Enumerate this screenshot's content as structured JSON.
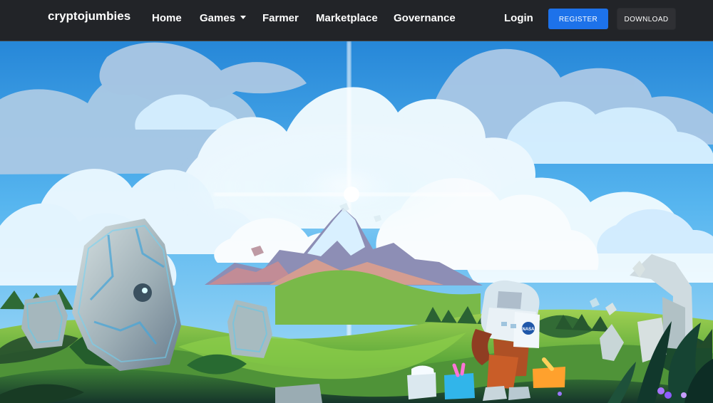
{
  "nav": {
    "brand": "cryptojumbies",
    "links": [
      "Home",
      "Games",
      "Farmer",
      "Marketplace",
      "Governance",
      "Login"
    ],
    "buttons": {
      "register": "REGISTER",
      "download": "DOWNLOAD"
    }
  },
  "hero": {
    "badge_text": "NASA"
  },
  "colors": {
    "nav_bg": "#222428",
    "register_bg": "#1d72ea",
    "download_bg": "#2f3034",
    "sky_top": "#2f91df",
    "sky_mid": "#6cc4f5"
  },
  "icons": {
    "games_dropdown": "caret-down-icon"
  }
}
